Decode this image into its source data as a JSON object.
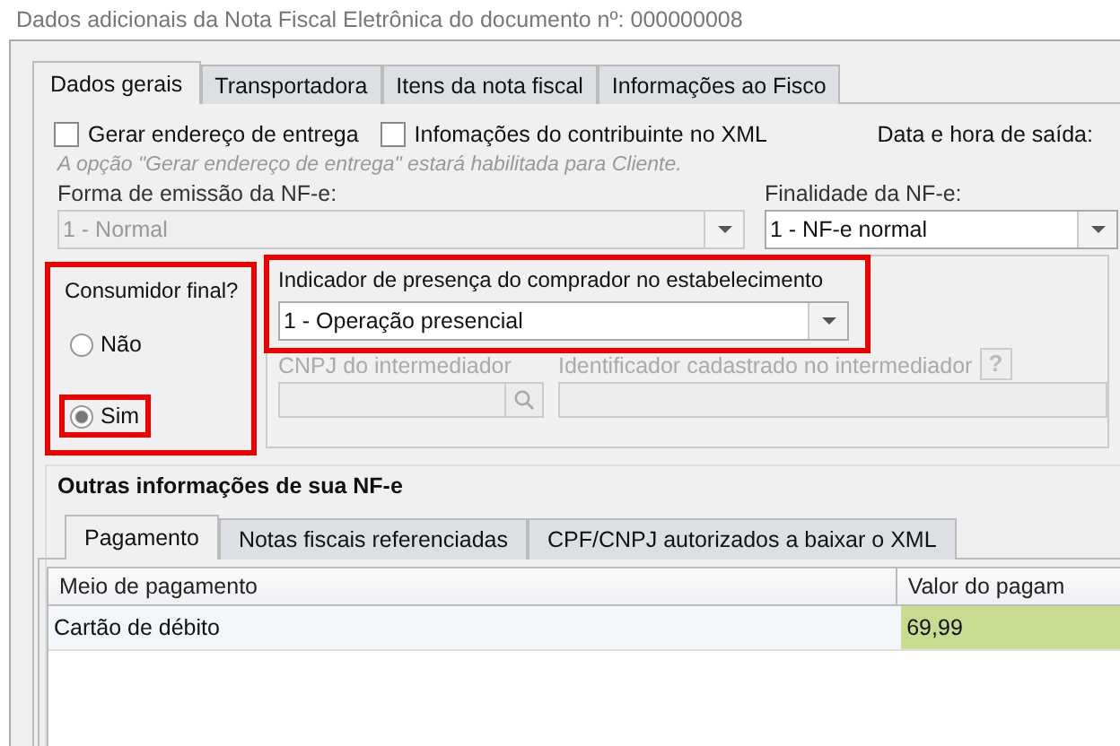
{
  "window": {
    "title": "Dados adicionais da Nota Fiscal Eletrônica do documento nº: 000000008"
  },
  "tabs": [
    {
      "label": "Dados gerais",
      "selected": true
    },
    {
      "label": "Transportadora",
      "selected": false
    },
    {
      "label": "Itens da nota fiscal",
      "selected": false
    },
    {
      "label": "Informações ao Fisco",
      "selected": false
    }
  ],
  "options": [
    {
      "label": "Gerar endereço de entrega",
      "checked": false
    },
    {
      "label": "Infomações do contribuinte no XML",
      "checked": false
    }
  ],
  "exit_datetime_label": "Data e hora de saída:",
  "hint": "A opção \"Gerar endereço de entrega\" estará habilitada para Cliente.",
  "emission_form": {
    "label": "Forma de emissão da NF-e:",
    "value": "1 - Normal",
    "disabled": true
  },
  "purpose": {
    "label": "Finalidade da NF-e:",
    "value": "1 - NF-e normal",
    "disabled": false
  },
  "final_consumer": {
    "label": "Consumidor final?",
    "highlighted": true,
    "choices": [
      {
        "label": "Não",
        "selected": false,
        "highlighted": false
      },
      {
        "label": "Sim",
        "selected": true,
        "highlighted": true
      }
    ]
  },
  "presence": {
    "label": "Indicador de presença do comprador no estabelecimento",
    "value": "1 - Operação presencial",
    "highlighted": true
  },
  "intermediary_cnpj": {
    "label": "CNPJ do intermediador",
    "disabled": true
  },
  "intermediary_id": {
    "label": "Identificador cadastrado no intermediador",
    "help": "?",
    "disabled": true
  },
  "other_info": {
    "title": "Outras informações de sua NF-e",
    "tabs": [
      {
        "label": "Pagamento",
        "selected": true
      },
      {
        "label": "Notas fiscais referenciadas",
        "selected": false
      },
      {
        "label": "CPF/CNPJ autorizados a baixar o XML",
        "selected": false
      }
    ],
    "table": {
      "columns": [
        "Meio de pagamento",
        "Valor do pagam"
      ],
      "rows": [
        {
          "cells": [
            "Cartão de débito",
            "69,99"
          ]
        }
      ]
    }
  }
}
